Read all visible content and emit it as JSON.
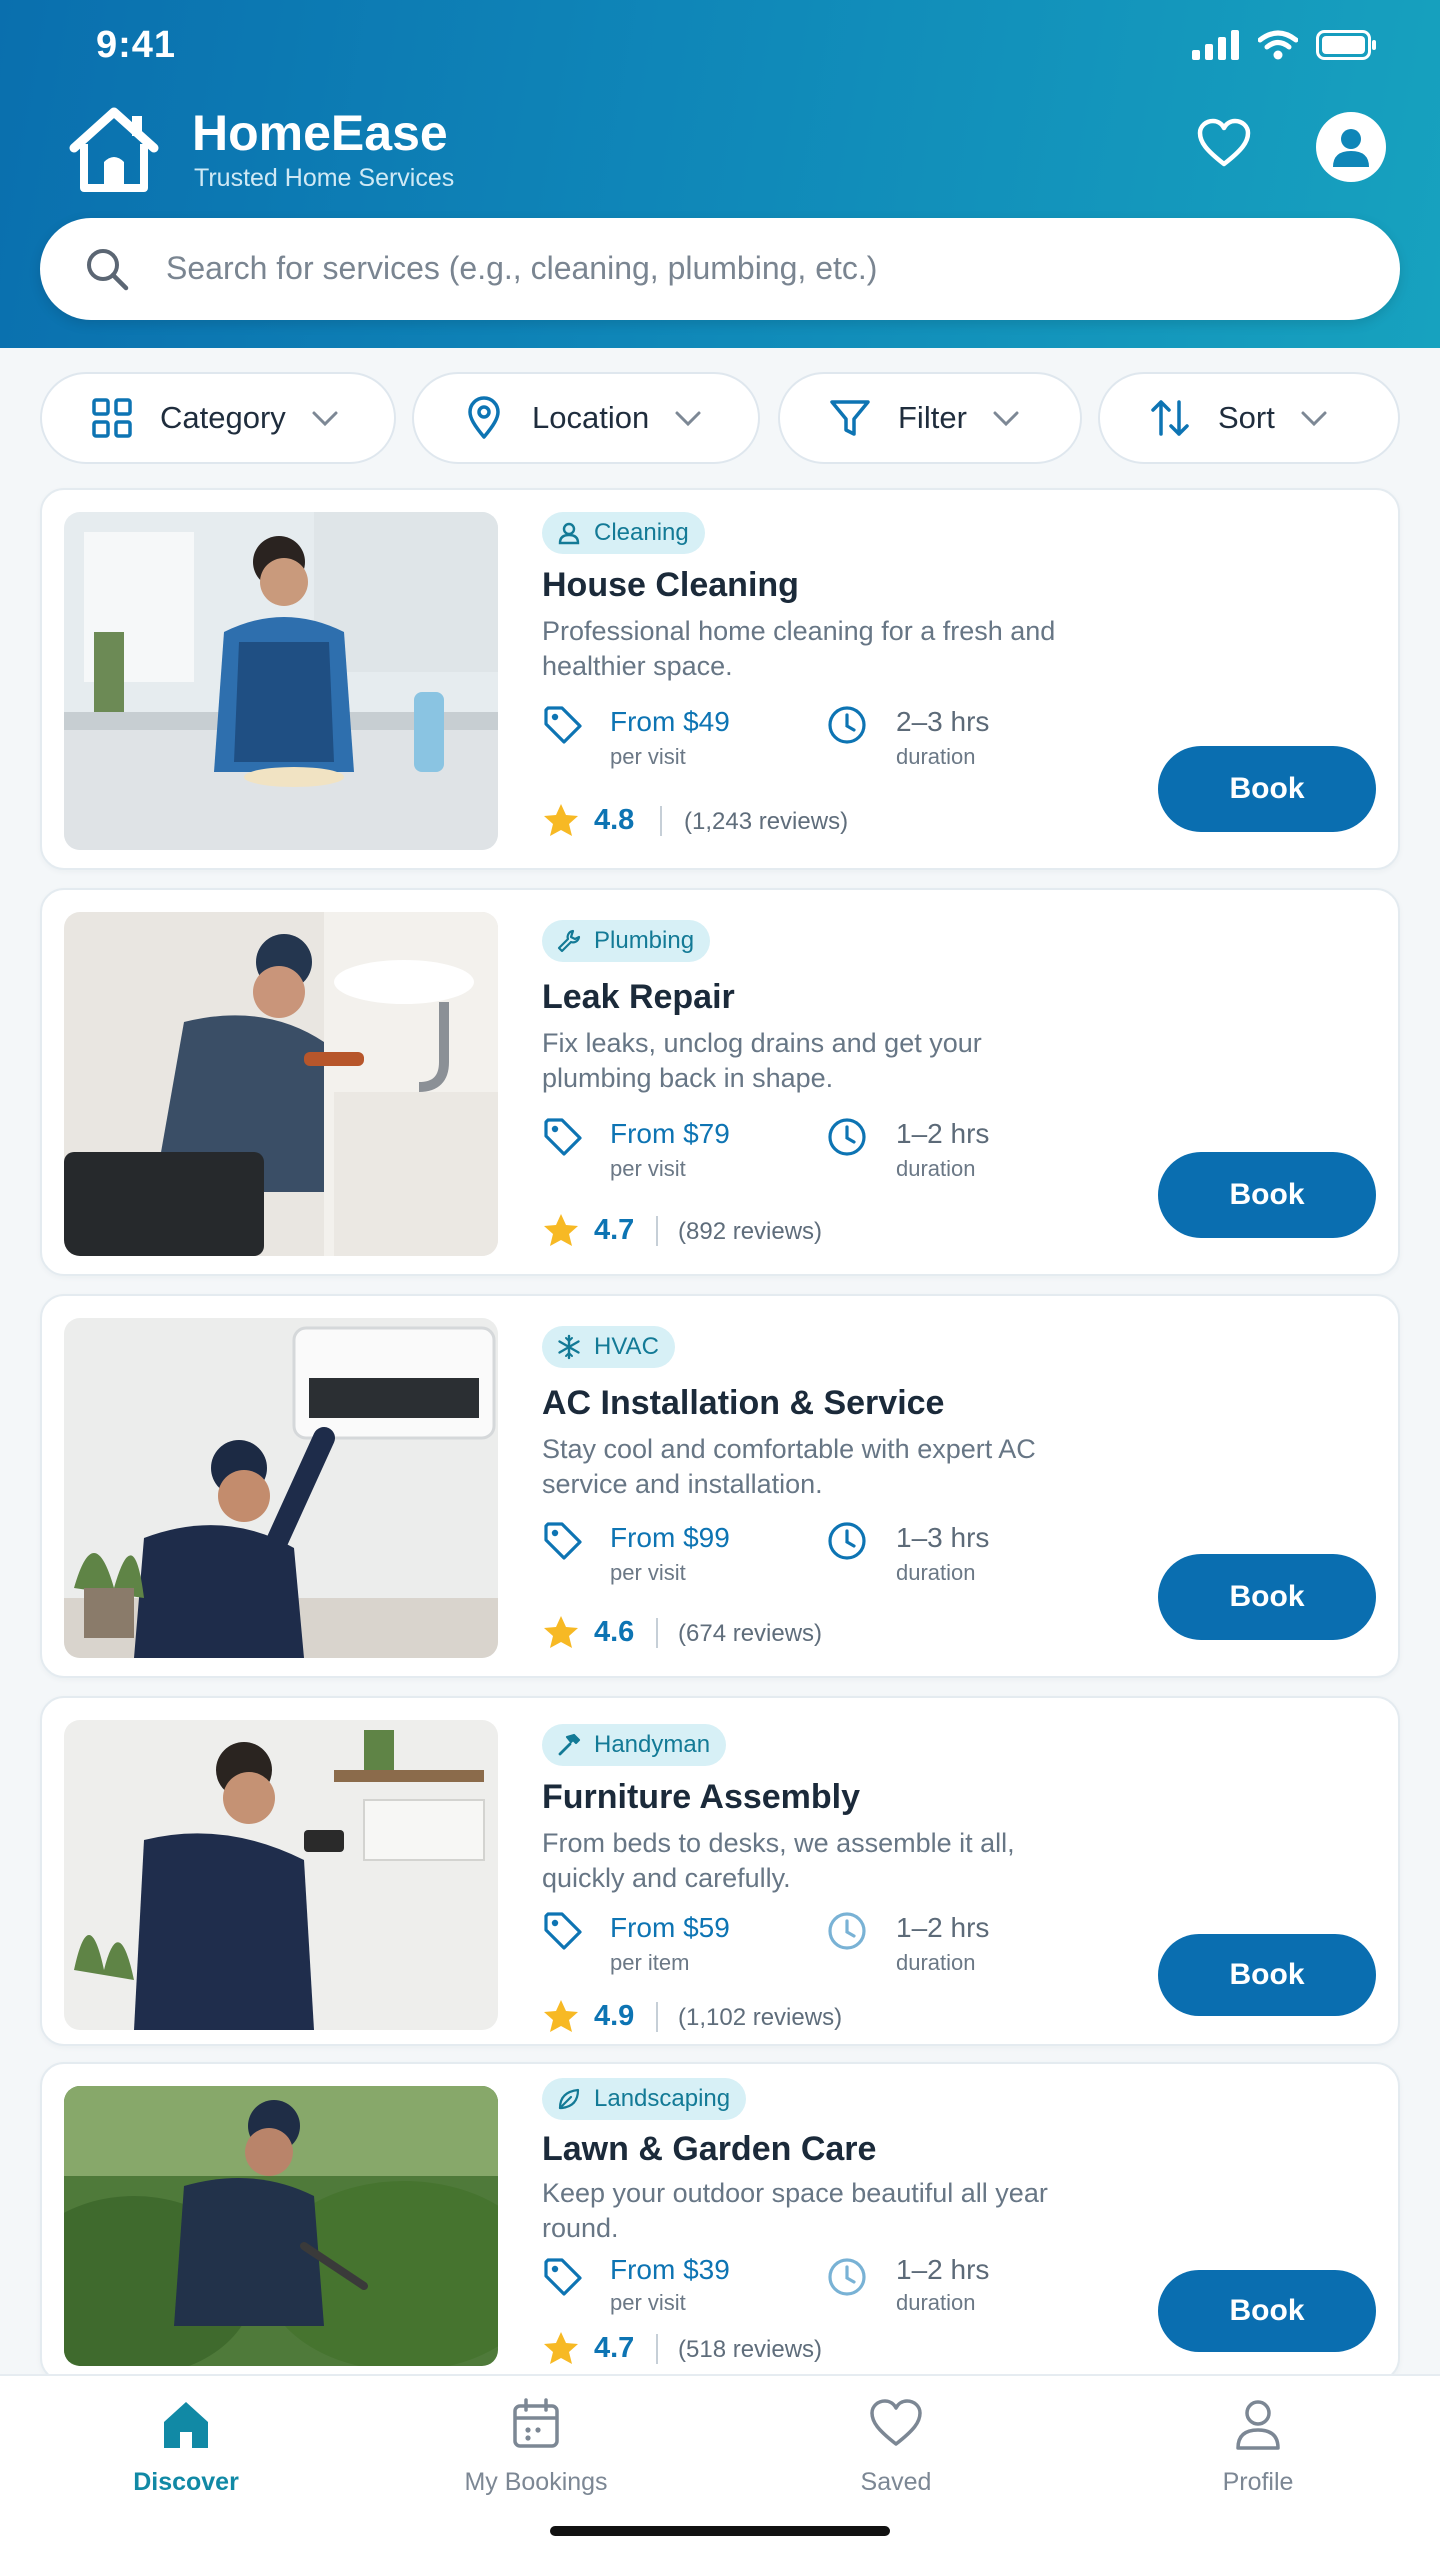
{
  "status_bar": {
    "time": "9:41"
  },
  "header": {
    "app_name": "HomeEase",
    "tagline": "Trusted Home Services",
    "favorites_icon": "heart-icon",
    "profile_icon": "user-avatar-icon"
  },
  "search": {
    "placeholder": "Search for services (e.g., cleaning, plumbing, etc.)"
  },
  "filters": [
    {
      "label": "Category",
      "icon": "grid-icon"
    },
    {
      "label": "Location",
      "icon": "location-pin-icon"
    },
    {
      "label": "Filter",
      "icon": "funnel-icon"
    },
    {
      "label": "Sort",
      "icon": "sort-arrows-icon"
    }
  ],
  "services": [
    {
      "category": "Cleaning",
      "category_icon": "person-icon",
      "title": "House Cleaning",
      "description": "Professional home cleaning for a fresh and healthier space.",
      "price": "From $49",
      "price_unit": "per visit",
      "duration": "2–3 hrs",
      "duration_label": "duration",
      "rating": "4.8",
      "reviews": "(1,243 reviews)",
      "book_label": "Book"
    },
    {
      "category": "Plumbing",
      "category_icon": "wrench-icon",
      "title": "Leak Repair",
      "description": "Fix leaks, unclog drains and get your plumbing back in shape.",
      "price": "From $79",
      "price_unit": "per visit",
      "duration": "1–2 hrs",
      "duration_label": "duration",
      "rating": "4.7",
      "reviews": "(892 reviews)",
      "book_label": "Book"
    },
    {
      "category": "HVAC",
      "category_icon": "snowflake-icon",
      "title": "AC Installation & Service",
      "description": "Stay cool and comfortable with expert AC service and installation.",
      "price": "From $99",
      "price_unit": "per visit",
      "duration": "1–3 hrs",
      "duration_label": "duration",
      "rating": "4.6",
      "reviews": "(674 reviews)",
      "book_label": "Book"
    },
    {
      "category": "Handyman",
      "category_icon": "hammer-icon",
      "title": "Furniture Assembly",
      "description": "From beds to desks, we assemble it all, quickly and carefully.",
      "price": "From $59",
      "price_unit": "per item",
      "duration": "1–2 hrs",
      "duration_label": "duration",
      "rating": "4.9",
      "reviews": "(1,102 reviews)",
      "book_label": "Book"
    },
    {
      "category": "Landscaping",
      "category_icon": "leaf-icon",
      "title": "Lawn & Garden Care",
      "description": "Keep your outdoor space beautiful all year round.",
      "price": "From $39",
      "price_unit": "per visit",
      "duration": "1–2 hrs",
      "duration_label": "duration",
      "rating": "4.7",
      "reviews": "(518 reviews)",
      "book_label": "Book"
    }
  ],
  "bottom_nav": [
    {
      "label": "Discover",
      "icon": "home-icon",
      "active": true
    },
    {
      "label": "My Bookings",
      "icon": "calendar-icon",
      "active": false
    },
    {
      "label": "Saved",
      "icon": "heart-icon",
      "active": false
    },
    {
      "label": "Profile",
      "icon": "person-icon",
      "active": false
    }
  ],
  "colors": {
    "header_start": "#0a6fae",
    "header_end": "#17a2bf",
    "accent": "#0a6eb0",
    "teal": "#1189a5",
    "star": "#f7b924",
    "badge_bg": "#d7f0f6"
  }
}
